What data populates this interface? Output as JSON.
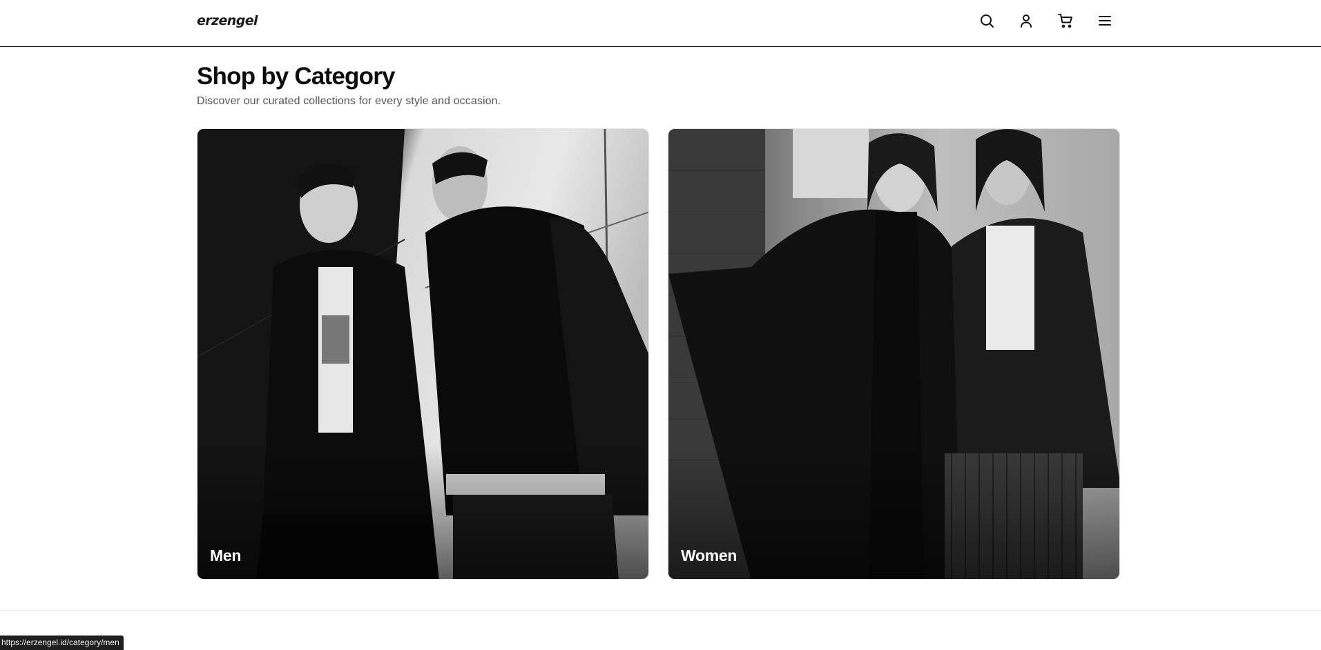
{
  "header": {
    "logo": "erzengel",
    "icons": [
      "search-icon",
      "user-icon",
      "cart-icon",
      "menu-icon"
    ]
  },
  "main": {
    "title": "Shop by Category",
    "subtitle": "Discover our curated collections for every style and occasion.",
    "categories": [
      {
        "label": "Men"
      },
      {
        "label": "Women"
      }
    ]
  },
  "status_bar": {
    "url": "https://erzengel.id/category/men"
  },
  "colors": {
    "text": "#0d0d0d",
    "muted": "#555555",
    "border": "#1a1a1a"
  }
}
